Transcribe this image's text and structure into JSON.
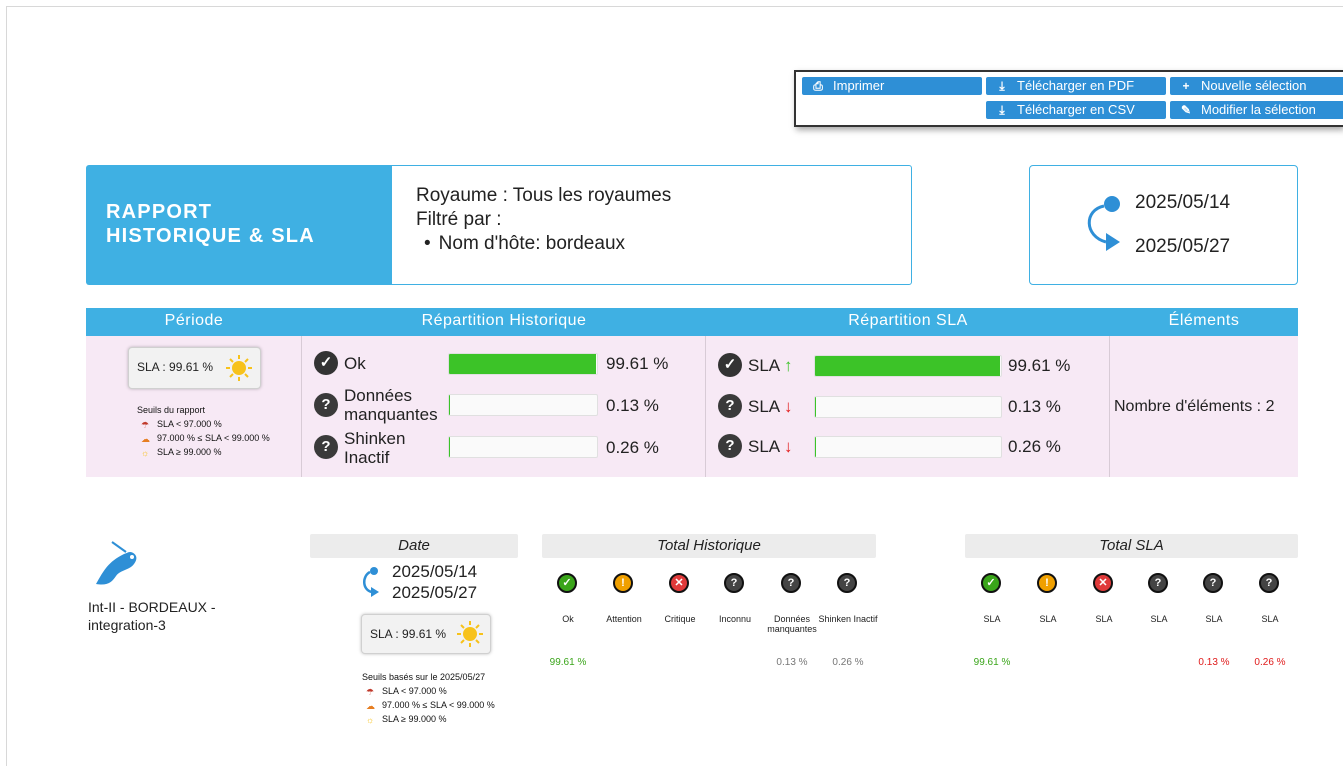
{
  "toolbar": {
    "print": "Imprimer",
    "pdf": "Télécharger en PDF",
    "new_selection": "Nouvelle sélection",
    "csv": "Télécharger en CSV",
    "modify_selection": "Modifier la sélection"
  },
  "report": {
    "title_line1": "RAPPORT",
    "title_line2": "HISTORIQUE & SLA",
    "realm": "Royaume : Tous les royaumes",
    "filtered_by": "Filtré par :",
    "filter_item": "Nom d'hôte: bordeaux",
    "date_start": "2025/05/14",
    "date_end": "2025/05/27"
  },
  "summary": {
    "headers": {
      "period": "Période",
      "hist": "Répartition Historique",
      "sla": "Répartition SLA",
      "elements": "Éléments"
    },
    "sla_value": "SLA : 99.61 %",
    "thresholds_title": "Seuils du rapport",
    "thresholds": [
      "SLA < 97.000 %",
      "97.000 % ≤ SLA < 99.000 %",
      "SLA ≥ 99.000 %"
    ],
    "hist_rows": [
      {
        "label": "Ok",
        "pct": "99.61 %",
        "fill": 0.9961
      },
      {
        "label": "Données manquantes",
        "pct": "0.13 %",
        "fill": 0.0013
      },
      {
        "label": "Shinken Inactif",
        "pct": "0.26 %",
        "fill": 0.0026
      }
    ],
    "sla_rows": [
      {
        "label": "SLA",
        "pct": "99.61 %",
        "fill": 0.9961
      },
      {
        "label": "SLA",
        "pct": "0.13 %",
        "fill": 0.0013
      },
      {
        "label": "SLA",
        "pct": "0.26 %",
        "fill": 0.0026
      }
    ],
    "element_count": "Nombre d'éléments : 2"
  },
  "element": {
    "name_line1": "Int-II - BORDEAUX -",
    "name_line2": "integration-3",
    "date_header": "Date",
    "date_start": "2025/05/14",
    "date_end": "2025/05/27",
    "sla_value": "SLA : 99.61 %",
    "thresholds_title": "Seuils basés sur le 2025/05/27",
    "thresholds": [
      "SLA < 97.000 %",
      "97.000 % ≤ SLA < 99.000 %",
      "SLA ≥ 99.000 %"
    ],
    "total_hist_header": "Total Historique",
    "total_sla_header": "Total SLA",
    "hist_cols": [
      {
        "label": "Ok",
        "value": "99.61 %"
      },
      {
        "label": "Attention",
        "value": ""
      },
      {
        "label": "Critique",
        "value": ""
      },
      {
        "label": "Inconnu",
        "value": ""
      },
      {
        "label": "Données manquantes",
        "value": "0.13 %"
      },
      {
        "label": "Shinken Inactif",
        "value": "0.26 %"
      }
    ],
    "sla_cols": [
      {
        "label": "SLA",
        "value": "99.61 %"
      },
      {
        "label": "SLA",
        "value": ""
      },
      {
        "label": "SLA",
        "value": ""
      },
      {
        "label": "SLA",
        "value": ""
      },
      {
        "label": "SLA",
        "value": "0.13 %"
      },
      {
        "label": "SLA",
        "value": "0.26 %"
      }
    ]
  },
  "colors": {
    "accent": "#3fb0e3",
    "button": "#2e8fd6",
    "ok_green": "#3cc328",
    "row_bg": "#f7e9f5",
    "error_red": "#e01b1b"
  }
}
